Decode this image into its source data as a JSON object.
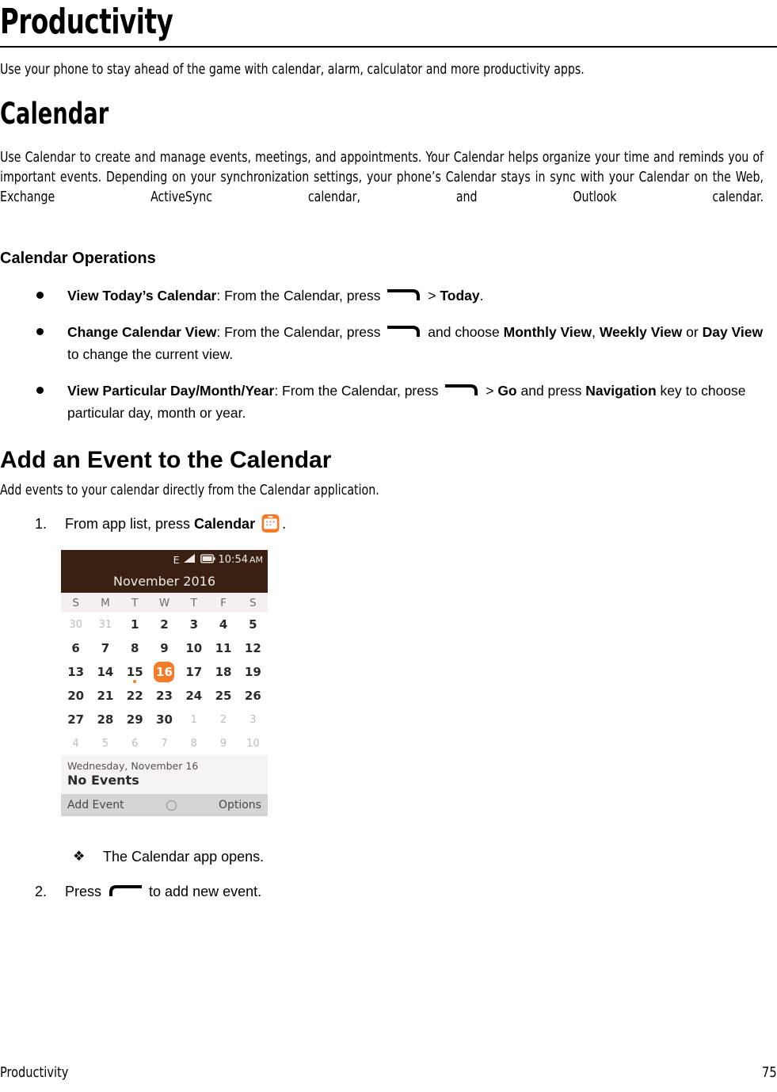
{
  "document": {
    "page_title": "Productivity",
    "intro": "Use your phone to stay ahead of the game with calendar, alarm, calculator and more productivity apps.",
    "footer": {
      "section": "Productivity",
      "page_number": "75"
    }
  },
  "calendar_section": {
    "heading": "Calendar",
    "description": "Use Calendar to create and manage events, meetings, and appointments. Your Calendar helps organize your time and reminds you of important events. Depending on your synchronization settings, your phone’s Calendar stays in sync with your Calendar on the Web, Exchange ActiveSync calendar, and Outlook calendar.",
    "operations_heading": "Calendar Operations",
    "operations": [
      {
        "term": "View Today’s Calendar",
        "t1": ": From the Calendar, press ",
        "key": "right-softkey-icon",
        "t2": " > ",
        "b2": "Today",
        "t3": "."
      },
      {
        "term": "Change Calendar View",
        "t1": ": From the Calendar, press ",
        "key": "right-softkey-icon",
        "t2": " and choose ",
        "b2": "Monthly View",
        "t3": ", ",
        "b3": "Weekly View",
        "t4": " or ",
        "b4": "Day View",
        "t5": " to change the current view."
      },
      {
        "term": "View Particular Day/Month/Year",
        "t1": ": From the Calendar, press ",
        "key": "right-softkey-icon",
        "t2": " > ",
        "b2": "Go",
        "t3": " and press ",
        "b3": "Navigation",
        "t4": " key to choose particular day, month or year."
      }
    ]
  },
  "add_event_section": {
    "heading": "Add an Event to the Calendar",
    "description": "Add events to your calendar directly from the Calendar application.",
    "steps": [
      {
        "number": "1.",
        "pre": "From app list, press ",
        "bold": "Calendar",
        "icon": "calendar-app-icon",
        "post": "."
      },
      {
        "number": "2.",
        "pre": "Press ",
        "icon": "left-softkey-icon",
        "post": " to add new event."
      }
    ],
    "result_note": {
      "marker": "❖",
      "text": "The Calendar app opens."
    }
  },
  "phone_screenshot": {
    "status_bar": {
      "network": "E",
      "signal_icon": "signal-bars-icon",
      "battery_icon": "battery-icon",
      "time": "10:54",
      "period": "AM"
    },
    "month_title": "November 2016",
    "weekday_headers": [
      "S",
      "M",
      "T",
      "W",
      "T",
      "F",
      "S"
    ],
    "weeks": [
      [
        {
          "d": "30",
          "dim": true
        },
        {
          "d": "31",
          "dim": true
        },
        {
          "d": "1"
        },
        {
          "d": "2"
        },
        {
          "d": "3"
        },
        {
          "d": "4"
        },
        {
          "d": "5"
        }
      ],
      [
        {
          "d": "6"
        },
        {
          "d": "7"
        },
        {
          "d": "8"
        },
        {
          "d": "9"
        },
        {
          "d": "10"
        },
        {
          "d": "11"
        },
        {
          "d": "12"
        }
      ],
      [
        {
          "d": "13"
        },
        {
          "d": "14"
        },
        {
          "d": "15",
          "dot": true
        },
        {
          "d": "16",
          "selected": true
        },
        {
          "d": "17"
        },
        {
          "d": "18"
        },
        {
          "d": "19"
        }
      ],
      [
        {
          "d": "20"
        },
        {
          "d": "21"
        },
        {
          "d": "22"
        },
        {
          "d": "23"
        },
        {
          "d": "24"
        },
        {
          "d": "25"
        },
        {
          "d": "26"
        }
      ],
      [
        {
          "d": "27"
        },
        {
          "d": "28"
        },
        {
          "d": "29"
        },
        {
          "d": "30"
        },
        {
          "d": "1",
          "dim": true
        },
        {
          "d": "2",
          "dim": true
        },
        {
          "d": "3",
          "dim": true
        }
      ],
      [
        {
          "d": "4",
          "dim": true
        },
        {
          "d": "5",
          "dim": true
        },
        {
          "d": "6",
          "dim": true
        },
        {
          "d": "7",
          "dim": true
        },
        {
          "d": "8",
          "dim": true
        },
        {
          "d": "9",
          "dim": true
        },
        {
          "d": "10",
          "dim": true
        }
      ]
    ],
    "selected_date_label": "Wednesday, November 16",
    "events_status": "No Events",
    "soft_keys": {
      "left": "Add Event",
      "center_icon": "ok-ring-icon",
      "right": "Options"
    },
    "colors": {
      "status_bar": "#3a2013",
      "accent": "#f47b28",
      "week_header": "#f5eff1",
      "event_box": "#f7f3f4",
      "soft_bar": "#d7d4d4"
    }
  }
}
